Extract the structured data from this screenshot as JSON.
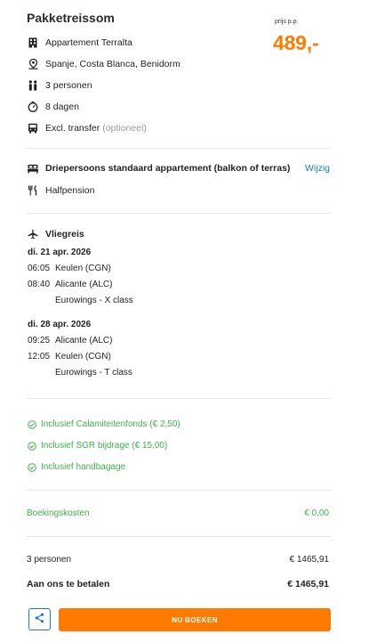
{
  "header": {
    "title": "Pakketreissom",
    "price_label": "prijs p.p.",
    "price": "489,-"
  },
  "package": {
    "hotel": "Appartement Terralta",
    "location": "Spanje, Costa Blanca, Benidorm",
    "persons": "3 personen",
    "duration": "8 dagen",
    "transfer": "Excl. transfer",
    "transfer_note": "(optioneel)"
  },
  "room": {
    "type": "Driepersoons standaard appartement (balkon of terras)",
    "change_label": "Wijzig",
    "board": "Halfpension"
  },
  "flights": {
    "title": "Vliegreis",
    "outbound": {
      "date": "di. 21 apr. 2026",
      "dep_time": "06:05",
      "dep_airport": "Keulen (CGN)",
      "arr_time": "08:40",
      "arr_airport": "Alicante (ALC)",
      "carrier": "Eurowings - X class"
    },
    "return": {
      "date": "di. 28 apr. 2026",
      "dep_time": "09:25",
      "dep_airport": "Alicante (ALC)",
      "arr_time": "12:05",
      "arr_airport": "Keulen (CGN)",
      "carrier": "Eurowings - T class"
    }
  },
  "inclusions": [
    "Inclusief Calamiteitenfonds (€ 2,50)",
    "Inclusief SGR bijdrage (€ 15,00)",
    "Inclusief handbagage"
  ],
  "fees": {
    "booking_label": "Boekingskosten",
    "booking_value": "€ 0,00"
  },
  "summary": {
    "persons_label": "3 personen",
    "persons_value": "€ 1465,91",
    "total_label": "Aan ons te betalen",
    "total_value": "€ 1465,91"
  },
  "actions": {
    "book_label": "NU BOEKEN",
    "share_icon": "share-icon"
  },
  "colors": {
    "accent": "#ff7a00",
    "link": "#1f78c8",
    "success": "#3fb24a"
  }
}
